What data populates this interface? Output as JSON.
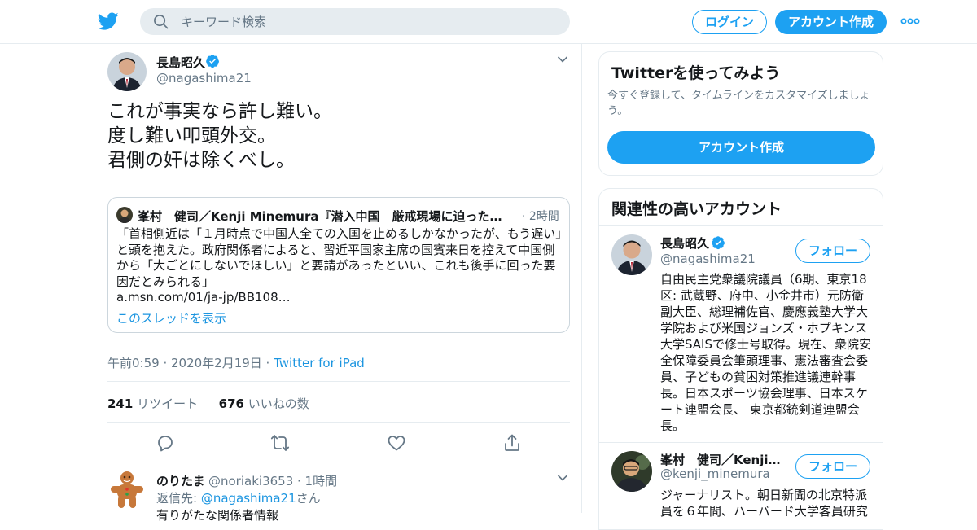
{
  "colors": {
    "accent": "#1da1f2",
    "link": "#1b95e0",
    "muted": "#657786",
    "border": "#e6ecf0"
  },
  "header": {
    "search_placeholder": "キーワード検索",
    "login_label": "ログイン",
    "signup_label": "アカウント作成"
  },
  "tweet": {
    "author_name": "長島昭久",
    "author_handle": "@nagashima21",
    "text": "これが事実なら許し難い。\n度し難い叩頭外交。\n君側の奸は除くべし。",
    "quote": {
      "author": "峯村　健司／Kenji Minemura『潜入中国　厳戒現場に迫った特派…",
      "time": "· 2時間",
      "text": "「首相側近は「１月時点で中国人全ての入国を止めるしかなかったが、もう遅い」と頭を抱えた。政府関係者によると、習近平国家主席の国賓来日を控えて中国側から「大ごとにしないでほしい」と要請があったといい、これも後手に回った要因だとみられる」\n a.msn.com/01/ja-jp/BB108…",
      "thread_link": "このスレッドを表示"
    },
    "timestamp": "午前0:59 · 2020年2月19日 · ",
    "source": "Twitter for iPad",
    "retweets_count": "241",
    "retweets_label": " リツイート",
    "likes_count": "676",
    "likes_label": " いいねの数"
  },
  "reply": {
    "author_name": "のりたま",
    "author_handle": "@noriaki3653 · 1時間",
    "reply_prefix": "返信先: ",
    "reply_to": "@nagashima21",
    "reply_suffix": "さん",
    "text": "有りがたな関係者情報"
  },
  "sidebar": {
    "signup_card": {
      "title": "Twitterを使ってみよう",
      "subtitle": "今すぐ登録して、タイムラインをカスタマイズしましょう。",
      "button": "アカウント作成"
    },
    "related": {
      "title": "関連性の高いアカウント",
      "accounts": [
        {
          "name": "長島昭久",
          "handle": "@nagashima21",
          "follow": "フォロー",
          "bio": "自由民主党衆議院議員（6期、東京18区: 武蔵野、府中、小金井市）元防衛副大臣、総理補佐官、慶應義塾大学大学院および米国ジョンズ・ホプキンス大学SAISで修士号取得。現在、衆院安全保障委員会筆頭理事、憲法審査会委員、子どもの貧困対策推進議連幹事長。日本スポーツ協会理事、日本スケート連盟会長、 東京都銃剣道連盟会長。"
        },
        {
          "name": "峯村　健司／Kenji …",
          "handle": "@kenji_minemura",
          "follow": "フォロー",
          "bio": "ジャーナリスト。朝日新聞の北京特派員を６年間、ハーバード大学客員研究"
        }
      ]
    }
  }
}
